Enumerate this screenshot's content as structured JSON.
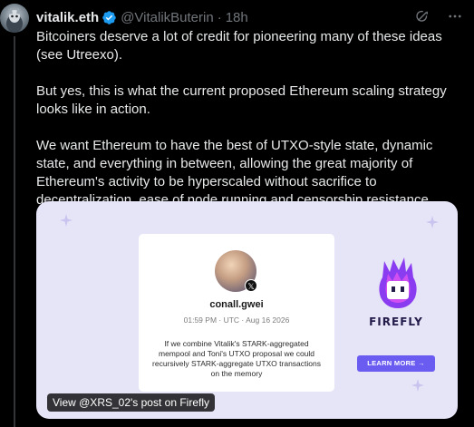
{
  "tweet": {
    "display_name": "vitalik.eth",
    "handle": "@VitalikButerin",
    "time": "18h",
    "paragraphs": [
      "Bitcoiners deserve a lot of credit for pioneering many of these ideas (see Utreexo).",
      "But yes, this is what the current proposed Ethereum scaling strategy looks like in action.",
      "We want Ethereum to have the best of UTXO-style state, dynamic state, and everything in between, allowing the great majority of Ethereum's activity to be hyperscaled without sacrifice to decentralization, ease of node running and censorship resistance."
    ]
  },
  "card": {
    "username": "conall.gwei",
    "timestamp": "01:59 PM · UTC · Aug 16 2026",
    "post_text": "If we combine Vitalik's STARK-aggregated mempool and Toni's UTXO proposal we could recursively STARK-aggregate UTXO transactions on the memory",
    "brand": "FIREFLY",
    "learn_more": "LEARN MORE →",
    "view_post": "View @XRS_02's post on Firefly"
  },
  "colors": {
    "background": "#000000",
    "text": "#e7e9ea",
    "muted": "#71767b",
    "verified": "#1d9bf0",
    "card_bg": "#e6e4f7",
    "button": "#6a5cf0"
  },
  "icons": {
    "verified": "verified-badge-icon",
    "grok": "grok-icon",
    "more": "more-options-icon",
    "logo": "firefly-logo-icon"
  }
}
